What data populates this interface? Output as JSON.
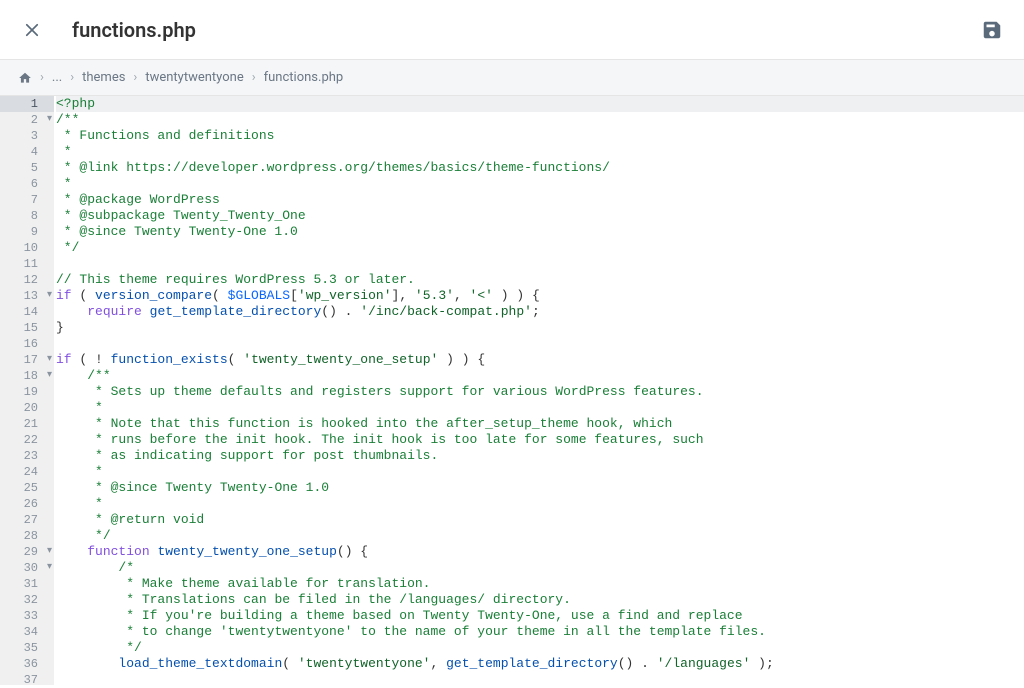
{
  "header": {
    "title": "functions.php"
  },
  "breadcrumb": {
    "ellipsis": "...",
    "items": [
      "themes",
      "twentytwentyone",
      "functions.php"
    ]
  },
  "editor": {
    "active_line": 1,
    "lines": [
      {
        "n": 1,
        "fold": false,
        "tokens": [
          [
            "tag",
            "<?php"
          ]
        ]
      },
      {
        "n": 2,
        "fold": true,
        "tokens": [
          [
            "cmt",
            "/**"
          ]
        ]
      },
      {
        "n": 3,
        "fold": false,
        "tokens": [
          [
            "cmt",
            " * Functions and definitions"
          ]
        ]
      },
      {
        "n": 4,
        "fold": false,
        "tokens": [
          [
            "cmt",
            " *"
          ]
        ]
      },
      {
        "n": 5,
        "fold": false,
        "tokens": [
          [
            "cmt",
            " * @link https://developer.wordpress.org/themes/basics/theme-functions/"
          ]
        ]
      },
      {
        "n": 6,
        "fold": false,
        "tokens": [
          [
            "cmt",
            " *"
          ]
        ]
      },
      {
        "n": 7,
        "fold": false,
        "tokens": [
          [
            "cmt",
            " * @package WordPress"
          ]
        ]
      },
      {
        "n": 8,
        "fold": false,
        "tokens": [
          [
            "cmt",
            " * @subpackage Twenty_Twenty_One"
          ]
        ]
      },
      {
        "n": 9,
        "fold": false,
        "tokens": [
          [
            "cmt",
            " * @since Twenty Twenty-One 1.0"
          ]
        ]
      },
      {
        "n": 10,
        "fold": false,
        "tokens": [
          [
            "cmt",
            " */"
          ]
        ]
      },
      {
        "n": 11,
        "fold": false,
        "tokens": [
          [
            "plain",
            ""
          ]
        ]
      },
      {
        "n": 12,
        "fold": false,
        "tokens": [
          [
            "cmt",
            "// This theme requires WordPress 5.3 or later."
          ]
        ]
      },
      {
        "n": 13,
        "fold": true,
        "tokens": [
          [
            "kwd",
            "if"
          ],
          [
            "plain",
            " ( "
          ],
          [
            "blue",
            "version_compare"
          ],
          [
            "plain",
            "( "
          ],
          [
            "var",
            "$GLOBALS"
          ],
          [
            "plain",
            "["
          ],
          [
            "str",
            "'wp_version'"
          ],
          [
            "plain",
            "], "
          ],
          [
            "str",
            "'5.3'"
          ],
          [
            "plain",
            ", "
          ],
          [
            "str",
            "'<'"
          ],
          [
            "plain",
            " ) ) {"
          ]
        ]
      },
      {
        "n": 14,
        "fold": false,
        "tokens": [
          [
            "plain",
            "    "
          ],
          [
            "kwd",
            "require"
          ],
          [
            "plain",
            " "
          ],
          [
            "blue",
            "get_template_directory"
          ],
          [
            "plain",
            "() . "
          ],
          [
            "str",
            "'/inc/back-compat.php'"
          ],
          [
            "plain",
            ";"
          ]
        ]
      },
      {
        "n": 15,
        "fold": false,
        "tokens": [
          [
            "plain",
            "}"
          ]
        ]
      },
      {
        "n": 16,
        "fold": false,
        "tokens": [
          [
            "plain",
            ""
          ]
        ]
      },
      {
        "n": 17,
        "fold": true,
        "tokens": [
          [
            "kwd",
            "if"
          ],
          [
            "plain",
            " ( ! "
          ],
          [
            "blue",
            "function_exists"
          ],
          [
            "plain",
            "( "
          ],
          [
            "str",
            "'twenty_twenty_one_setup'"
          ],
          [
            "plain",
            " ) ) {"
          ]
        ]
      },
      {
        "n": 18,
        "fold": true,
        "tokens": [
          [
            "plain",
            "    "
          ],
          [
            "cmt",
            "/**"
          ]
        ]
      },
      {
        "n": 19,
        "fold": false,
        "tokens": [
          [
            "plain",
            "    "
          ],
          [
            "cmt",
            " * Sets up theme defaults and registers support for various WordPress features."
          ]
        ]
      },
      {
        "n": 20,
        "fold": false,
        "tokens": [
          [
            "plain",
            "    "
          ],
          [
            "cmt",
            " *"
          ]
        ]
      },
      {
        "n": 21,
        "fold": false,
        "tokens": [
          [
            "plain",
            "    "
          ],
          [
            "cmt",
            " * Note that this function is hooked into the after_setup_theme hook, which"
          ]
        ]
      },
      {
        "n": 22,
        "fold": false,
        "tokens": [
          [
            "plain",
            "    "
          ],
          [
            "cmt",
            " * runs before the init hook. The init hook is too late for some features, such"
          ]
        ]
      },
      {
        "n": 23,
        "fold": false,
        "tokens": [
          [
            "plain",
            "    "
          ],
          [
            "cmt",
            " * as indicating support for post thumbnails."
          ]
        ]
      },
      {
        "n": 24,
        "fold": false,
        "tokens": [
          [
            "plain",
            "    "
          ],
          [
            "cmt",
            " *"
          ]
        ]
      },
      {
        "n": 25,
        "fold": false,
        "tokens": [
          [
            "plain",
            "    "
          ],
          [
            "cmt",
            " * @since Twenty Twenty-One 1.0"
          ]
        ]
      },
      {
        "n": 26,
        "fold": false,
        "tokens": [
          [
            "plain",
            "    "
          ],
          [
            "cmt",
            " *"
          ]
        ]
      },
      {
        "n": 27,
        "fold": false,
        "tokens": [
          [
            "plain",
            "    "
          ],
          [
            "cmt",
            " * @return void"
          ]
        ]
      },
      {
        "n": 28,
        "fold": false,
        "tokens": [
          [
            "plain",
            "    "
          ],
          [
            "cmt",
            " */"
          ]
        ]
      },
      {
        "n": 29,
        "fold": true,
        "tokens": [
          [
            "plain",
            "    "
          ],
          [
            "kwd",
            "function"
          ],
          [
            "plain",
            " "
          ],
          [
            "blue",
            "twenty_twenty_one_setup"
          ],
          [
            "plain",
            "() {"
          ]
        ]
      },
      {
        "n": 30,
        "fold": true,
        "tokens": [
          [
            "plain",
            "        "
          ],
          [
            "cmt",
            "/*"
          ]
        ]
      },
      {
        "n": 31,
        "fold": false,
        "tokens": [
          [
            "plain",
            "        "
          ],
          [
            "cmt",
            " * Make theme available for translation."
          ]
        ]
      },
      {
        "n": 32,
        "fold": false,
        "tokens": [
          [
            "plain",
            "        "
          ],
          [
            "cmt",
            " * Translations can be filed in the /languages/ directory."
          ]
        ]
      },
      {
        "n": 33,
        "fold": false,
        "tokens": [
          [
            "plain",
            "        "
          ],
          [
            "cmt",
            " * If you're building a theme based on Twenty Twenty-One, use a find and replace"
          ]
        ]
      },
      {
        "n": 34,
        "fold": false,
        "tokens": [
          [
            "plain",
            "        "
          ],
          [
            "cmt",
            " * to change 'twentytwentyone' to the name of your theme in all the template files."
          ]
        ]
      },
      {
        "n": 35,
        "fold": false,
        "tokens": [
          [
            "plain",
            "        "
          ],
          [
            "cmt",
            " */"
          ]
        ]
      },
      {
        "n": 36,
        "fold": false,
        "tokens": [
          [
            "plain",
            "        "
          ],
          [
            "blue",
            "load_theme_textdomain"
          ],
          [
            "plain",
            "( "
          ],
          [
            "str",
            "'twentytwentyone'"
          ],
          [
            "plain",
            ", "
          ],
          [
            "blue",
            "get_template_directory"
          ],
          [
            "plain",
            "() . "
          ],
          [
            "str",
            "'/languages'"
          ],
          [
            "plain",
            " );"
          ]
        ]
      },
      {
        "n": 37,
        "fold": false,
        "tokens": [
          [
            "plain",
            ""
          ]
        ]
      }
    ]
  }
}
